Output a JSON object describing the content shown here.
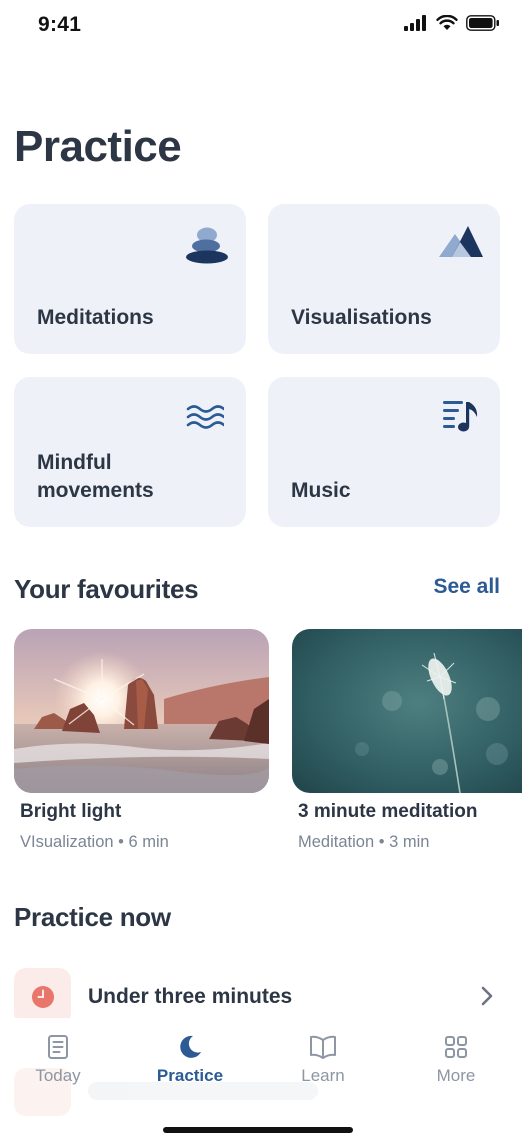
{
  "status_bar": {
    "time": "9:41"
  },
  "page": {
    "title": "Practice"
  },
  "categories": [
    {
      "label": "Meditations",
      "icon": "stones-icon"
    },
    {
      "label": "Visualisations",
      "icon": "mountains-icon"
    },
    {
      "label": "Mindful movements",
      "icon": "waves-icon"
    },
    {
      "label": "Music",
      "icon": "music-list-icon"
    }
  ],
  "favourites": {
    "title": "Your favourites",
    "see_all": "See all",
    "items": [
      {
        "title": "Bright light",
        "meta": "VIsualization • 6 min"
      },
      {
        "title": "3 minute meditation",
        "meta": "Meditation • 3 min"
      }
    ]
  },
  "practice_now": {
    "title": "Practice now",
    "items": [
      {
        "label": "Under three minutes",
        "icon": "clock-icon"
      }
    ]
  },
  "nav": [
    {
      "label": "Today",
      "icon": "book-icon",
      "active": false
    },
    {
      "label": "Practice",
      "icon": "moon-icon",
      "active": true
    },
    {
      "label": "Learn",
      "icon": "open-book-icon",
      "active": false
    },
    {
      "label": "More",
      "icon": "grid-icon",
      "active": false
    }
  ],
  "colors": {
    "accent": "#2b5a94",
    "card_bg": "#eef2f8",
    "icon_dark": "#1c355e",
    "icon_light": "#8fa9cf",
    "clock_icon": "#e8766a"
  }
}
